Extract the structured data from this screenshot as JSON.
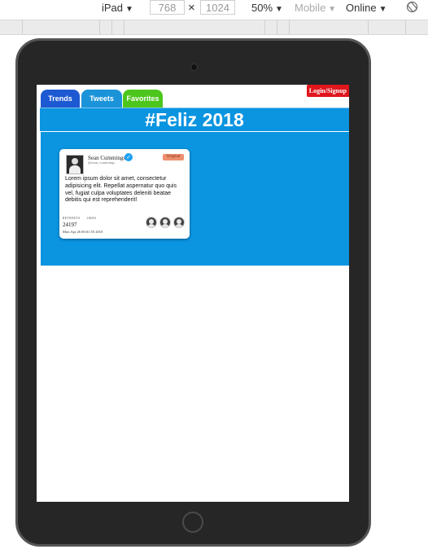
{
  "devtools": {
    "device": "iPad",
    "width": "768",
    "height": "1024",
    "separator": "×",
    "zoom": "50%",
    "mode": "Mobile",
    "network": "Online",
    "caret": "▼",
    "rotate_icon": "rotate-icon"
  },
  "app": {
    "login_label": "Login/Signup",
    "tabs": [
      {
        "label": "Trends",
        "color": "#1d59d2"
      },
      {
        "label": "Tweets",
        "color": "#1b93d9"
      },
      {
        "label": "Favorites",
        "color": "#4cc61c"
      }
    ],
    "banner_title": "#Feliz 2018",
    "accent_color": "#0b94e0",
    "tweet": {
      "name": "Sean Cummings",
      "handle": "@sean_cummings",
      "badge": "Original",
      "text": "Lorem ipsum dolor sit amet, consectetur adipisicing elit. Repellat aspernatur quo quis vel, fugiat culpa voluptates deleniti beatae debitis qui est reprehenderit!",
      "stat_labels": [
        "RETWEETS",
        "LIKES"
      ],
      "retweets": "24197",
      "timestamp": "Mon Apr 26 06:01:55 2010",
      "verified_icon": "✓"
    }
  }
}
